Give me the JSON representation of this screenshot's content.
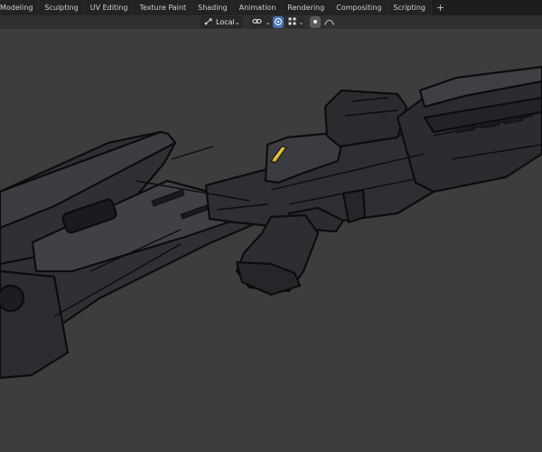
{
  "workspaces": {
    "tabs": [
      "Modeling",
      "Sculpting",
      "UV Editing",
      "Texture Paint",
      "Shading",
      "Animation",
      "Rendering",
      "Compositing",
      "Scripting"
    ],
    "add_label": "+"
  },
  "header": {
    "pivot": {
      "icon": "transform-orientation-icon",
      "value": "Local"
    },
    "snap": {
      "icon": "link-icon",
      "chevron": "chevron-down-icon"
    },
    "proportional": {
      "icon": "proportional-edit-icon"
    },
    "grid_snap": {
      "icon": "grid-snap-icon"
    },
    "falloff": {
      "icon": "falloff-curve-icon"
    }
  },
  "colors": {
    "background": "#3d3d3d",
    "model_fill": "#343539",
    "model_outline": "#0c0c0e",
    "accent": "#c9a224"
  }
}
